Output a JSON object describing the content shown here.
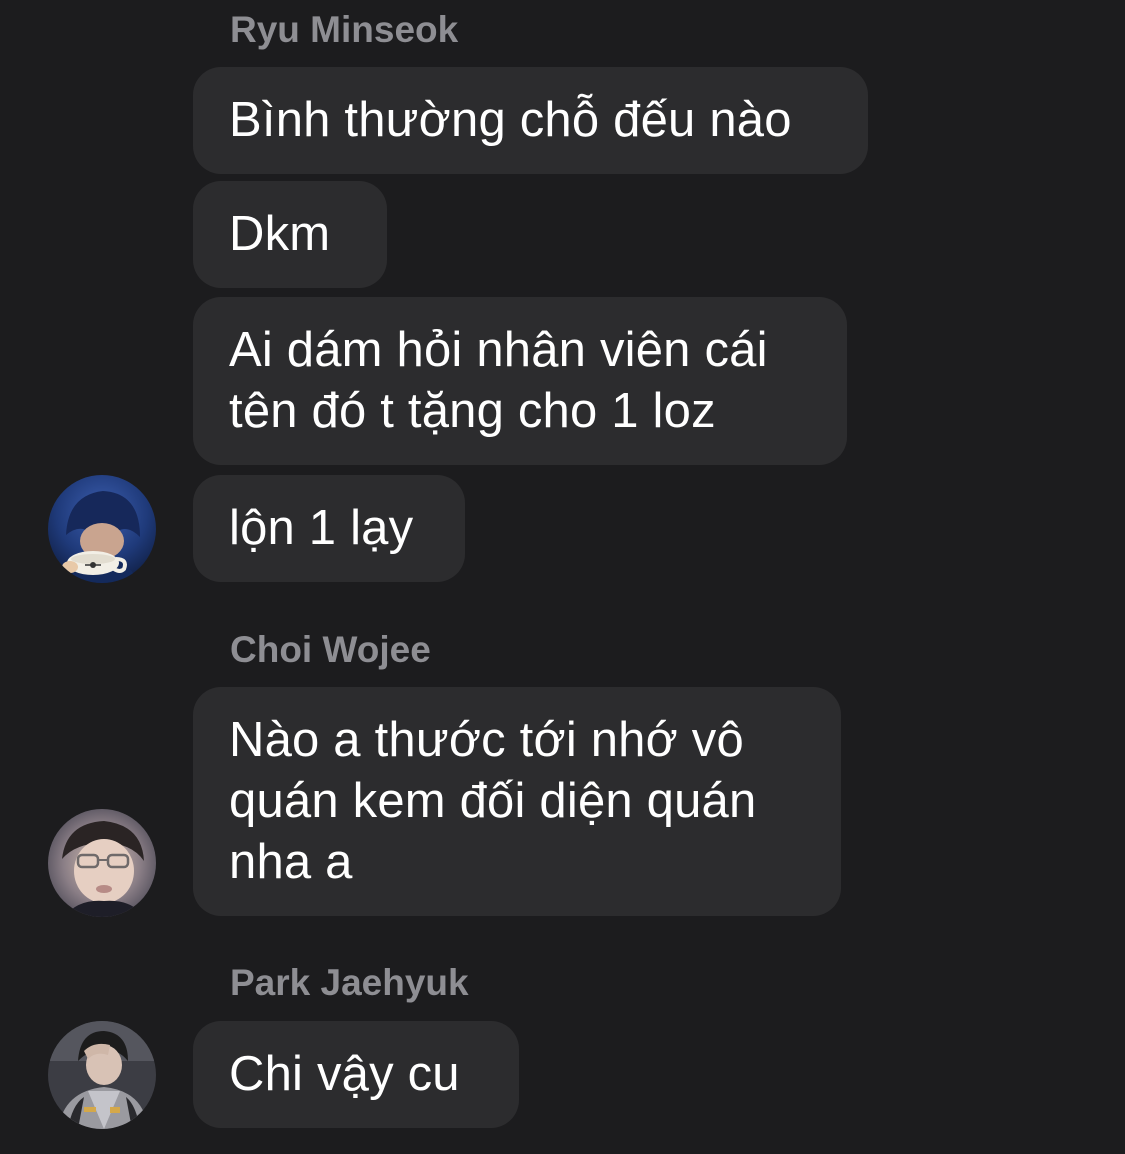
{
  "messages": {
    "group1": {
      "sender": "Ryu Minseok",
      "bubble1": "Bình thường chỗ đếu nào",
      "bubble2": "Dkm",
      "bubble3": "Ai dám hỏi nhân viên cái tên đó t tặng cho 1 loz",
      "bubble4": "lộn 1 lạy"
    },
    "group2": {
      "sender": "Choi Wojee",
      "bubble1": "Nào a thước tới nhớ vô quán kem đối diện quán nha a"
    },
    "group3": {
      "sender": "Park Jaehyuk",
      "bubble1": "Chi vậy cu"
    }
  },
  "colors": {
    "background": "#1c1c1e",
    "bubble": "#2c2c2e",
    "sender_name": "#8e8e93",
    "message_text": "#ffffff"
  },
  "icons": {
    "avatar1": "avatar-ryu-minseok-icon",
    "avatar2": "avatar-choi-wojee-icon",
    "avatar3": "avatar-park-jaehyuk-icon"
  }
}
